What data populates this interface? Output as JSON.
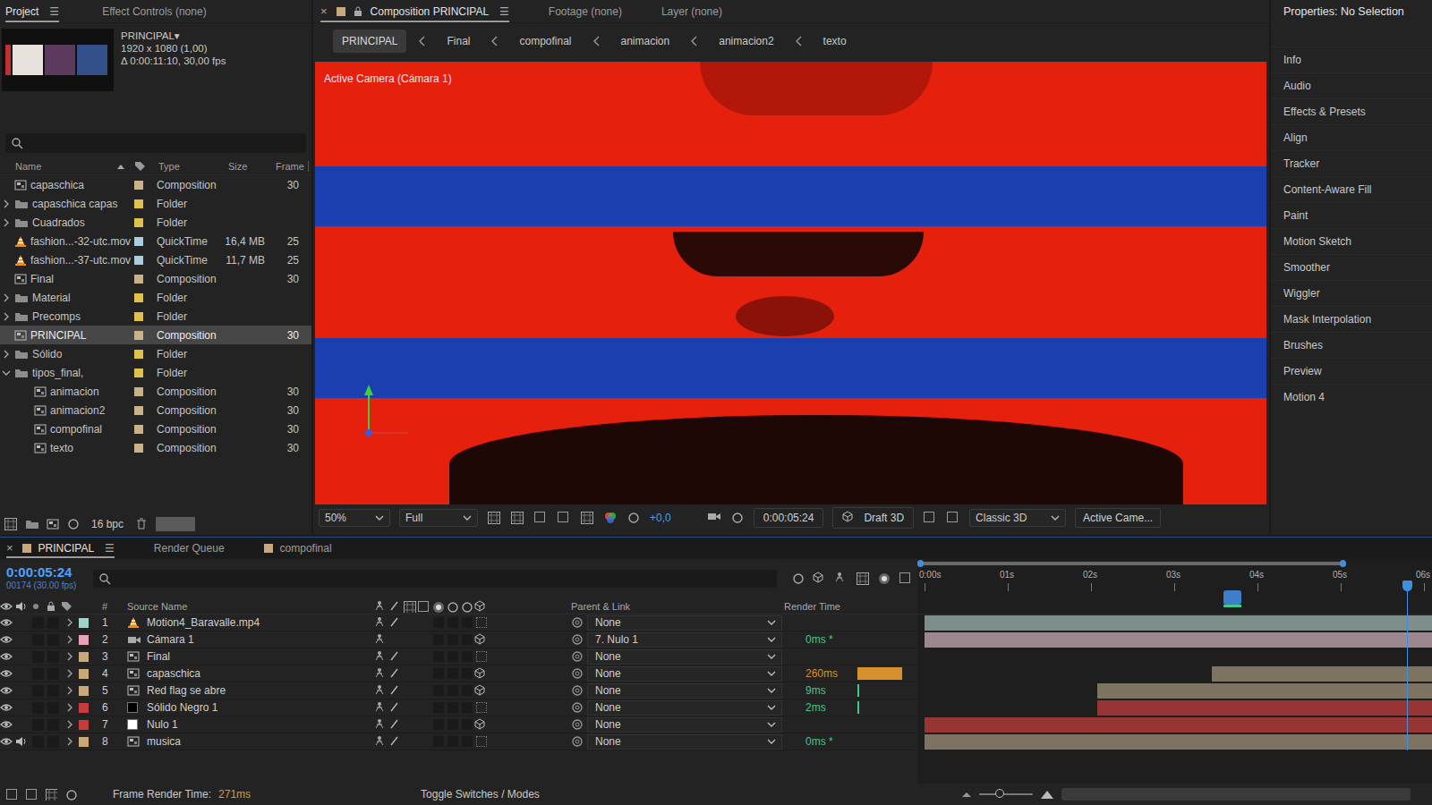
{
  "project": {
    "tabs": [
      {
        "label": "Project",
        "selected": true,
        "menu": "☰"
      },
      {
        "label": "Effect Controls (none)",
        "selected": false
      }
    ],
    "info": {
      "name": "PRINCIPAL▾",
      "size": "1920 x 1080 (1,00)",
      "duration": "Δ 0:00:11:10, 30,00 fps"
    },
    "columns": [
      "Name",
      "Type",
      "Size",
      "Frame"
    ],
    "items": [
      {
        "name": "capaschica",
        "type": "Composition",
        "size": "",
        "frame": "30",
        "kind": "composition",
        "color": "#c9b189",
        "depth": 0,
        "selected": false
      },
      {
        "name": "capaschica capas",
        "type": "Folder",
        "size": "",
        "frame": "",
        "kind": "folder",
        "color": "#e0c24a",
        "depth": 0,
        "expanded": false,
        "selected": false
      },
      {
        "name": "Cuadrados",
        "type": "Folder",
        "size": "",
        "frame": "",
        "kind": "folder",
        "color": "#e0c24a",
        "depth": 0,
        "expanded": false,
        "selected": false
      },
      {
        "name": "fashion...-32-utc.mov",
        "type": "QuickTime",
        "size": "16,4 MB",
        "frame": "25",
        "kind": "quicktime",
        "color": "#a9cfdf",
        "depth": 0,
        "selected": false
      },
      {
        "name": "fashion...-37-utc.mov",
        "type": "QuickTime",
        "size": "11,7 MB",
        "frame": "25",
        "kind": "quicktime",
        "color": "#a9cfdf",
        "depth": 0,
        "selected": false
      },
      {
        "name": "Final",
        "type": "Composition",
        "size": "",
        "frame": "30",
        "kind": "composition",
        "color": "#c9b189",
        "depth": 0,
        "selected": false
      },
      {
        "name": "Material",
        "type": "Folder",
        "size": "",
        "frame": "",
        "kind": "folder",
        "color": "#e0c24a",
        "depth": 0,
        "expanded": false,
        "selected": false
      },
      {
        "name": "Precomps",
        "type": "Folder",
        "size": "",
        "frame": "",
        "kind": "folder",
        "color": "#e0c24a",
        "depth": 0,
        "expanded": false,
        "selected": false
      },
      {
        "name": "PRINCIPAL",
        "type": "Composition",
        "size": "",
        "frame": "30",
        "kind": "composition",
        "color": "#c9b189",
        "depth": 0,
        "selected": true
      },
      {
        "name": "Sólido",
        "type": "Folder",
        "size": "",
        "frame": "",
        "kind": "folder",
        "color": "#e0c24a",
        "depth": 0,
        "expanded": false,
        "selected": false
      },
      {
        "name": "tipos_final,",
        "type": "Folder",
        "size": "",
        "frame": "",
        "kind": "folder",
        "color": "#e0c24a",
        "depth": 0,
        "expanded": true,
        "selected": false
      },
      {
        "name": "animacion",
        "type": "Composition",
        "size": "",
        "frame": "30",
        "kind": "composition",
        "color": "#c9b189",
        "depth": 1,
        "selected": false
      },
      {
        "name": "animacion2",
        "type": "Composition",
        "size": "",
        "frame": "30",
        "kind": "composition",
        "color": "#c9b189",
        "depth": 1,
        "selected": false
      },
      {
        "name": "compofinal",
        "type": "Composition",
        "size": "",
        "frame": "30",
        "kind": "composition",
        "color": "#c9b189",
        "depth": 1,
        "selected": false
      },
      {
        "name": "texto",
        "type": "Composition",
        "size": "",
        "frame": "30",
        "kind": "composition",
        "color": "#c9b189",
        "depth": 1,
        "selected": false
      }
    ],
    "bpc": "16 bpc"
  },
  "viewer": {
    "tabs": [
      {
        "label": "Composition PRINCIPAL",
        "selected": true,
        "close": "×",
        "menu": "☰",
        "kind": "composition"
      },
      {
        "label": "Footage (none)",
        "selected": false,
        "kind": "panel"
      },
      {
        "label": "Layer (none)",
        "selected": false,
        "kind": "panel"
      }
    ],
    "breadcrumbs": [
      {
        "label": "PRINCIPAL",
        "selected": true
      },
      {
        "label": "Final",
        "selected": false
      },
      {
        "label": "compofinal",
        "selected": false
      },
      {
        "label": "animacion",
        "selected": false
      },
      {
        "label": "animacion2",
        "selected": false
      },
      {
        "label": "texto",
        "selected": false
      }
    ],
    "camera_label": "Active Camera (Cámara 1)",
    "toolbar": {
      "zoom": "50%",
      "resolution": "Full",
      "exposure": "+0,0",
      "time": "0:00:05:24",
      "draft": "Draft 3D",
      "renderer": "Classic 3D",
      "view": "Active Came..."
    }
  },
  "properties": {
    "title": "Properties: No Selection",
    "items": [
      "Info",
      "Audio",
      "Effects & Presets",
      "Align",
      "Tracker",
      "Content-Aware Fill",
      "Paint",
      "Motion Sketch",
      "Smoother",
      "Wiggler",
      "Mask Interpolation",
      "Brushes",
      "Preview",
      "Motion 4"
    ]
  },
  "timeline": {
    "tabs": [
      {
        "label": "PRINCIPAL",
        "selected": true,
        "close": "×",
        "menu": "☰",
        "kind": "composition"
      },
      {
        "label": "Render Queue",
        "selected": false,
        "kind": "panel"
      },
      {
        "label": "compofinal",
        "selected": false,
        "kind": "composition"
      }
    ],
    "timecode": "0:00:05:24",
    "frames": "00174 (30.00 fps)",
    "columns": {
      "number": "#",
      "source": "Source Name",
      "parent": "Parent & Link",
      "render": "Render Time"
    },
    "ticks": [
      "0:00s",
      "01s",
      "02s",
      "03s",
      "04s",
      "05s",
      "06s"
    ],
    "playhead": 5.8,
    "work_area_end": 5.03,
    "marker": 3.7,
    "layers": [
      {
        "number": "1",
        "name": "Motion4_Baravalle.mp4",
        "kind": "footage",
        "color": "#9fd3c9",
        "visible": true,
        "audio": false,
        "quality": true,
        "three_d": false,
        "parent": "None",
        "render": null,
        "bar": {
          "start": 0,
          "color": "#7e8f8b"
        }
      },
      {
        "number": "2",
        "name": "Cámara 1",
        "kind": "camera",
        "color": "#e6a3b5",
        "visible": true,
        "audio": false,
        "quality": false,
        "three_d": true,
        "parent": "7. Nulo 1",
        "render": {
          "text": "0ms *",
          "level": 0,
          "color": "#3fc98a"
        },
        "bar": {
          "start": 0,
          "color": "#9c8790"
        }
      },
      {
        "number": "3",
        "name": "Final",
        "kind": "composition",
        "color": "#c9a97c",
        "visible": true,
        "audio": false,
        "quality": true,
        "three_d": false,
        "parent": "None",
        "render": null,
        "bar": null
      },
      {
        "number": "4",
        "name": "capaschica",
        "kind": "composition",
        "color": "#c9a97c",
        "visible": true,
        "audio": false,
        "quality": true,
        "three_d": true,
        "parent": "None",
        "render": {
          "text": "260ms",
          "level": 1,
          "color": "#d8902e"
        },
        "bar": {
          "start": 3.45,
          "color": "#7d7361"
        }
      },
      {
        "number": "5",
        "name": "Red flag se abre",
        "kind": "composition",
        "color": "#c9a97c",
        "visible": true,
        "audio": false,
        "quality": true,
        "three_d": true,
        "parent": "None",
        "render": {
          "text": "9ms",
          "level": 0.035,
          "color": "#3fc98a"
        },
        "bar": {
          "start": 2.08,
          "color": "#7d7361"
        }
      },
      {
        "number": "6",
        "name": "Sólido Negro 1",
        "kind": "solid",
        "solid_color": "#000000",
        "color": "#c63b3b",
        "visible": true,
        "audio": false,
        "quality": true,
        "three_d": false,
        "parent": "None",
        "render": {
          "text": "2ms",
          "level": 0.01,
          "color": "#3fc98a"
        },
        "bar": {
          "start": 2.08,
          "color": "#973434"
        }
      },
      {
        "number": "7",
        "name": "Nulo 1",
        "kind": "solid",
        "solid_color": "#ffffff",
        "color": "#c63b3b",
        "visible": true,
        "audio": false,
        "quality": true,
        "three_d": true,
        "parent": "None",
        "render": null,
        "bar": {
          "start": 0,
          "color": "#973434"
        }
      },
      {
        "number": "8",
        "name": "musica",
        "kind": "composition",
        "color": "#c9a97c",
        "visible": true,
        "audio": true,
        "quality": true,
        "three_d": false,
        "parent": "None",
        "render": {
          "text": "0ms *",
          "level": 0,
          "color": "#3fc98a"
        },
        "bar": {
          "start": 0,
          "color": "#7d7361"
        }
      }
    ],
    "footer": {
      "label": "Frame Render Time:",
      "value": "271ms",
      "toggle": "Toggle Switches / Modes"
    }
  }
}
